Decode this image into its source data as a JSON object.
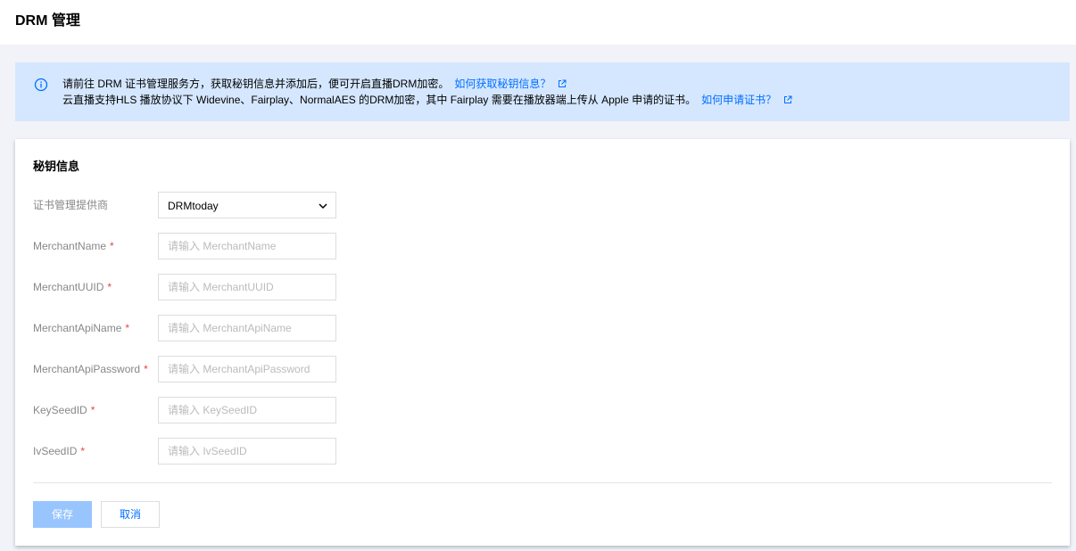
{
  "header": {
    "title": "DRM 管理"
  },
  "notice": {
    "line1_text": "请前往 DRM 证书管理服务方，获取秘钥信息并添加后，便可开启直播DRM加密。",
    "line1_link": "如何获取秘钥信息？",
    "line2_text": "云直播支持HLS 播放协议下 Widevine、Fairplay、NormalAES 的DRM加密，其中 Fairplay 需要在播放器端上传从 Apple 申请的证书。",
    "line2_link": "如何申请证书？",
    "accent_color": "#006eff"
  },
  "card": {
    "section_title": "秘钥信息",
    "provider": {
      "label": "证书管理提供商",
      "selected": "DRMtoday"
    },
    "fields": [
      {
        "label": "MerchantName",
        "placeholder": "请输入 MerchantName"
      },
      {
        "label": "MerchantUUID",
        "placeholder": "请输入 MerchantUUID"
      },
      {
        "label": "MerchantApiName",
        "placeholder": "请输入 MerchantApiName"
      },
      {
        "label": "MerchantApiPassword",
        "placeholder": "请输入 MerchantApiPassword"
      },
      {
        "label": "KeySeedID",
        "placeholder": "请输入 KeySeedID"
      },
      {
        "label": "IvSeedID",
        "placeholder": "请输入 IvSeedID"
      }
    ],
    "required_mark": "*",
    "save_label": "保存",
    "cancel_label": "取消"
  }
}
